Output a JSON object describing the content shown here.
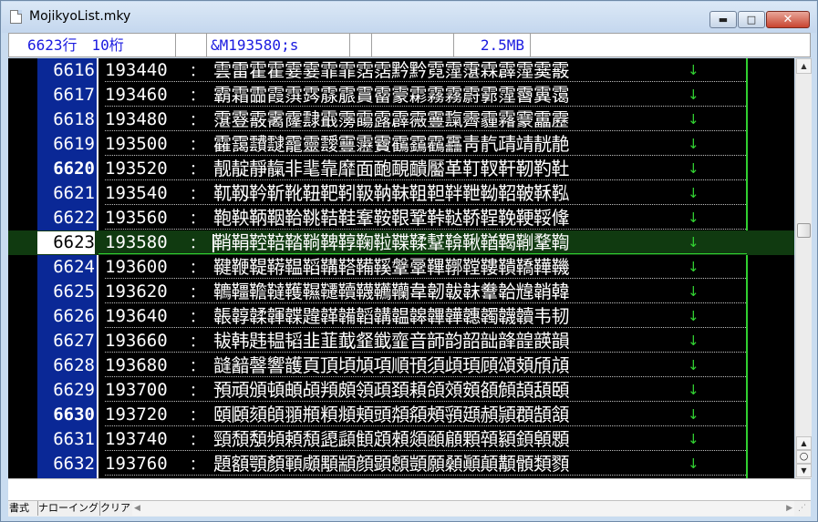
{
  "window": {
    "title": "MojikyoList.mky",
    "minimize_glyph": "▬",
    "maximize_glyph": "□",
    "close_glyph": "✕"
  },
  "statusbar": {
    "lines": "6623行　10桁",
    "code": "&M193580;s",
    "size": "2.5MB"
  },
  "editor": {
    "separator": "：",
    "eol_mark": "↓",
    "current_line": "6623",
    "rows": [
      {
        "line": "6616",
        "code": "193440",
        "chars": "雲雷霍霍霎霎霏霏霑霑黔黔霓霪霮霖霹霪霙霰"
      },
      {
        "line": "6617",
        "code": "193460",
        "chars": "霸霜霝霞霟霠霡霢霣霤霥霦霧霧霨霩霪霫霬霭"
      },
      {
        "line": "6618",
        "code": "193480",
        "chars": "霮霯霰霱霳霴霵霶霷露霹霺霻霼霽霾霿靀靁靂"
      },
      {
        "line": "6619",
        "code": "193500",
        "chars": "靃靄靅靆靇靈靉靊靋靌靍靎靏靐靑靔靕靖靗靘"
      },
      {
        "line": "6620",
        "code": "193520",
        "chars": "靓靛靜靝非靟靠靡面靤靦靧靨革靪靫靬靭靮靯",
        "bold": true
      },
      {
        "line": "6621",
        "code": "193540",
        "chars": "靰靱靲靳靴靵靶靷靸靹靺靻靼靽靾靿鞀鞁鞂鞃"
      },
      {
        "line": "6622",
        "code": "193560",
        "chars": "鞄鞅鞆鞇鞈鞉鞊鞋鞌鞍鞎鞏鞐鞑鞒鞓鞔鞕鞖鞗"
      },
      {
        "line": "6623",
        "code": "193580",
        "chars": "鞘鞙鞚鞛鞜鞝鞞鞟鞠鞡鞢鞣鞤鞥鞦鞧鞨鞩鞪鞫"
      },
      {
        "line": "6624",
        "code": "193600",
        "chars": "鞬鞭鞮鞯鞰鞱鞲鞳鞴鞵鞶鞷鞸鞹鞺鞻鞼鞽鞾鞿"
      },
      {
        "line": "6625",
        "code": "193620",
        "chars": "韀韁韂韃韄韅韆韇韈韉韊韋韌韍韎韏韐韑韒韓"
      },
      {
        "line": "6626",
        "code": "193640",
        "chars": "韔韕韖韗韘韙韚韛韜韝韞韟韠韡韢韣韤韥韦韧"
      },
      {
        "line": "6627",
        "code": "193660",
        "chars": "韨韩韪韫韬韭韮韯韰韱韲音韴韵韶韷韸韹韺韻"
      },
      {
        "line": "6628",
        "code": "193680",
        "chars": "韼韽韾響頀頁頂頃頄項順頇須頉頊頋頌頍頎頏"
      },
      {
        "line": "6629",
        "code": "193700",
        "chars": "預頑頒頓頔頕頖頗領頙頚頛頜頝頞頟頠頡頢頣"
      },
      {
        "line": "6630",
        "code": "193720",
        "chars": "頤頥頦頧頨頩頪頫頬頭頮頯頰頱頲頳頴頵頶頷",
        "bold": true
      },
      {
        "line": "6631",
        "code": "193740",
        "chars": "頸頹頺頻頼頽頾頿顀顁顂顃顄顅顆顇顈顉顊顋"
      },
      {
        "line": "6632",
        "code": "193760",
        "chars": "題額顎顏顐顑顒顓顔顕顖顗願顙顚顛顜顝類顟"
      }
    ]
  },
  "bottombar": {
    "format_label": "書式",
    "narrowing_label": "ナローイング",
    "clear_label": "クリア"
  },
  "scrollbar": {
    "up_glyph": "▲",
    "prev_glyph": "▲",
    "jump_glyph": "○",
    "next_glyph": "▼"
  },
  "colors": {
    "gutter": "#0a2896",
    "editor_bg": "#000000",
    "eol": "#32d232",
    "current_line_bg": "#103a10",
    "status_text": "#1a1ae0"
  }
}
